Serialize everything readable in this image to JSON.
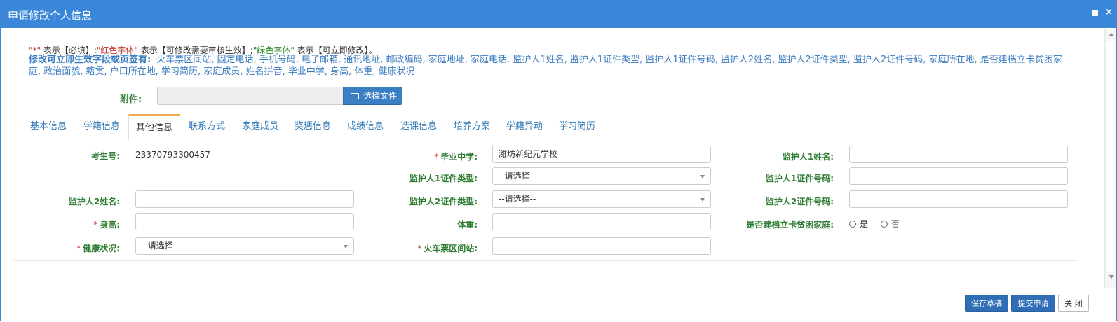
{
  "dialog": {
    "title": "申请修改个人信息",
    "close_glyph": "×"
  },
  "legend": {
    "required_mark": "\"*\"",
    "part1": " 表示【必填】;",
    "red_text": "\"红色字体\"",
    "part2": " 表示【可修改需要审核生效】;",
    "green_text": "\"绿色字体\"",
    "part3": " 表示【可立即修改】。"
  },
  "immediate_fields": {
    "lead": "修改可立即生效字段或页签有:",
    "list": "火车票区间站, 固定电话, 手机号码, 电子邮箱, 通讯地址, 邮政编码, 家庭地址, 家庭电话, 监护人1姓名, 监护人1证件类型, 监护人1证件号码, 监护人2姓名, 监护人2证件类型, 监护人2证件号码, 家庭所在地, 是否建档立卡贫困家庭, 政治面貌, 籍贯, 户口所在地, 学习简历, 家庭成员, 姓名拼音, 毕业中学, 身高, 体重, 健康状况"
  },
  "attachment": {
    "label": "附件:",
    "button_label": "选择文件"
  },
  "tabs": [
    {
      "label": "基本信息"
    },
    {
      "label": "学籍信息"
    },
    {
      "label": "其他信息"
    },
    {
      "label": "联系方式"
    },
    {
      "label": "家庭成员"
    },
    {
      "label": "奖惩信息"
    },
    {
      "label": "成绩信息"
    },
    {
      "label": "选课信息"
    },
    {
      "label": "培养方案"
    },
    {
      "label": "学籍异动"
    },
    {
      "label": "学习简历"
    }
  ],
  "active_tab": "其他信息",
  "form": {
    "exam_no_label": "考生号:",
    "exam_no_value": "23370793300457",
    "grad_school_label": "毕业中学:",
    "grad_school_value": "潍坊新纪元学校",
    "guardian1_name_label": "监护人1姓名:",
    "guardian1_name_value": "",
    "guardian1_idtype_label": "监护人1证件类型:",
    "guardian1_idtype_value": "--请选择--",
    "guardian1_idno_label": "监护人1证件号码:",
    "guardian1_idno_value": "",
    "guardian2_name_label": "监护人2姓名:",
    "guardian2_name_value": "",
    "guardian2_idtype_label": "监护人2证件类型:",
    "guardian2_idtype_value": "--请选择--",
    "guardian2_idno_label": "监护人2证件号码:",
    "guardian2_idno_value": "",
    "height_label": "身高:",
    "height_value": "",
    "weight_label": "体重:",
    "weight_value": "",
    "poverty_label": "是否建档立卡贫困家庭:",
    "poverty_yes": "是",
    "poverty_no": "否",
    "health_label": "健康状况:",
    "health_value": "--请选择--",
    "train_station_label": "火车票区间站:",
    "train_station_value": "",
    "required_star": "*"
  },
  "footer": {
    "save_draft": "保存草稿",
    "submit": "提交申请",
    "close": "关 闭"
  }
}
